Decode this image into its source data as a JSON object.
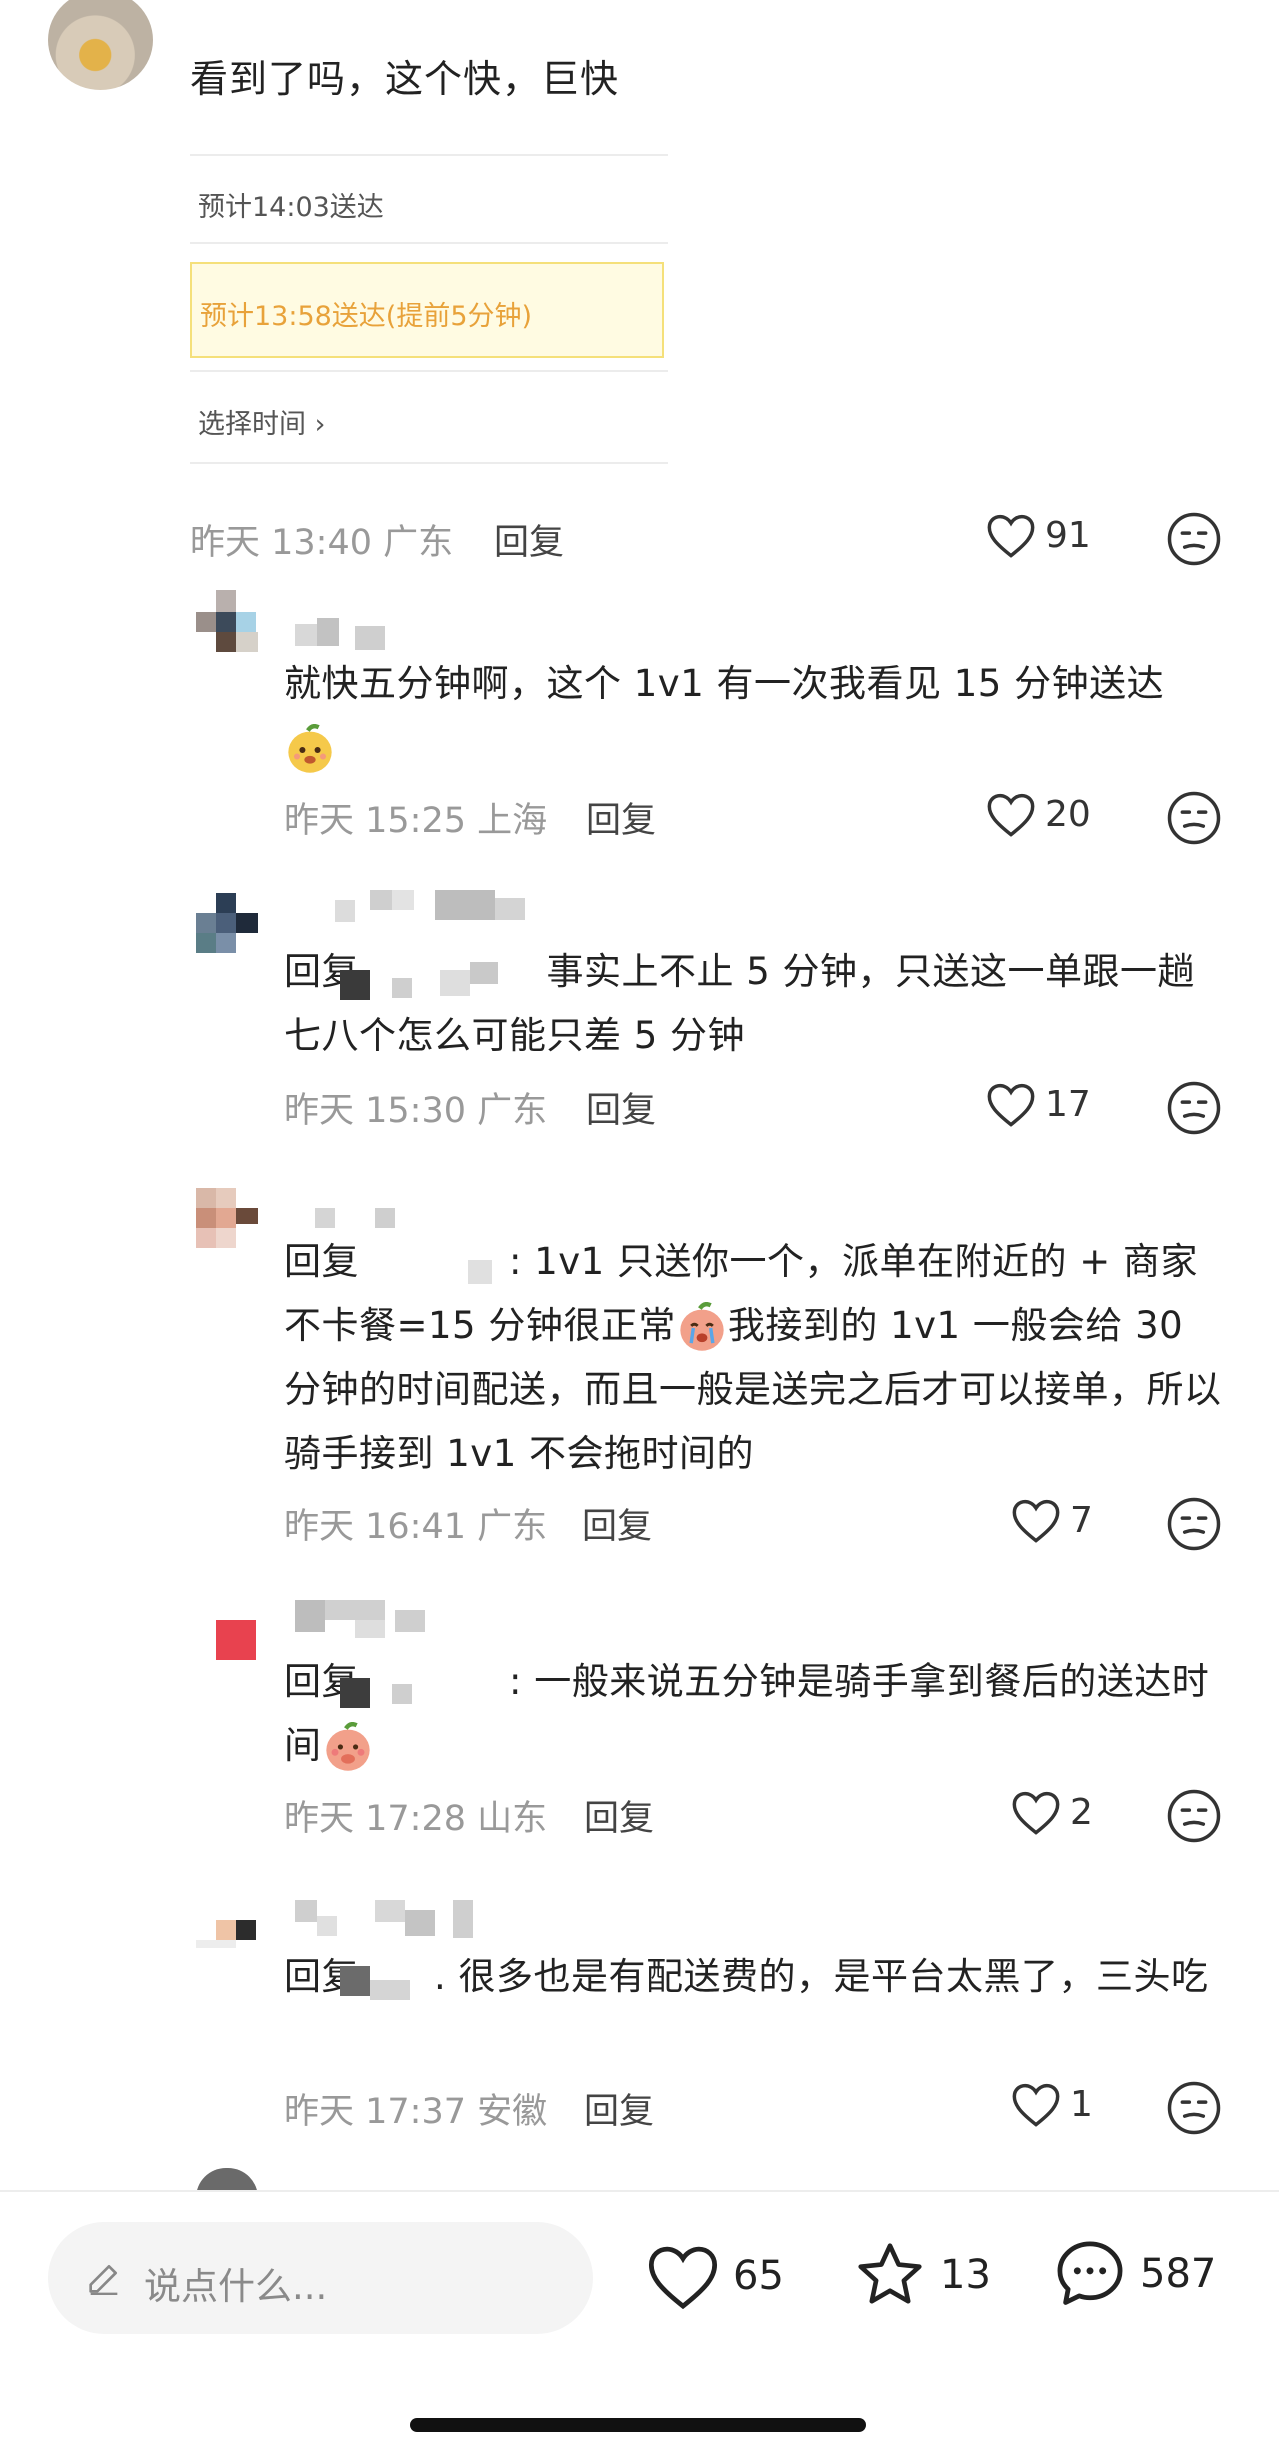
{
  "post": {
    "text": "看到了吗，这个快，巨快",
    "options": [
      "预计14:03送达",
      "预计13:58送达(提前5分钟)",
      "选择时间"
    ],
    "chevron": "›",
    "meta": "昨天 13:40 广东",
    "reply_label": "回复",
    "likes": "91"
  },
  "comments": [
    {
      "text": "就快五分钟啊，这个 1v1 有一次我看见 15 分钟送达",
      "emoji": "mango-face-emoji",
      "meta": "昨天 15:25 上海",
      "reply_label": "回复",
      "likes": "20"
    },
    {
      "text": "回复　　　　　事实上不止 5 分钟，只送这一单跟一趟七八个怎么可能只差 5 分钟",
      "meta": "昨天 15:30 广东",
      "reply_label": "回复",
      "likes": "17"
    },
    {
      "text_a": "回复　　　　: 1v1 只送你一个，派单在附近的 + 商家不卡餐=15 分钟很正常",
      "text_b": "我接到的 1v1 一般会给 30 分钟的时间配送，而且一般是送完之后才可以接单，所以骑手接到 1v1 不会拖时间的",
      "emoji": "crying-face-emoji",
      "meta": "昨天 16:41 广东",
      "reply_label": "回复",
      "likes": "7"
    },
    {
      "text": "回复　　　　: 一般来说五分钟是骑手拿到餐后的送达时间",
      "emoji": "shy-face-emoji",
      "meta": "昨天 17:28 山东",
      "reply_label": "回复",
      "likes": "2"
    },
    {
      "text": "回复　　. 很多也是有配送费的，是平台太黑了，三头吃",
      "meta": "昨天 17:37 安徽",
      "reply_label": "回复",
      "likes": "1"
    }
  ],
  "bottom_bar": {
    "input_placeholder": "说点什么...",
    "likes": "65",
    "favorites": "13",
    "comments": "587"
  }
}
